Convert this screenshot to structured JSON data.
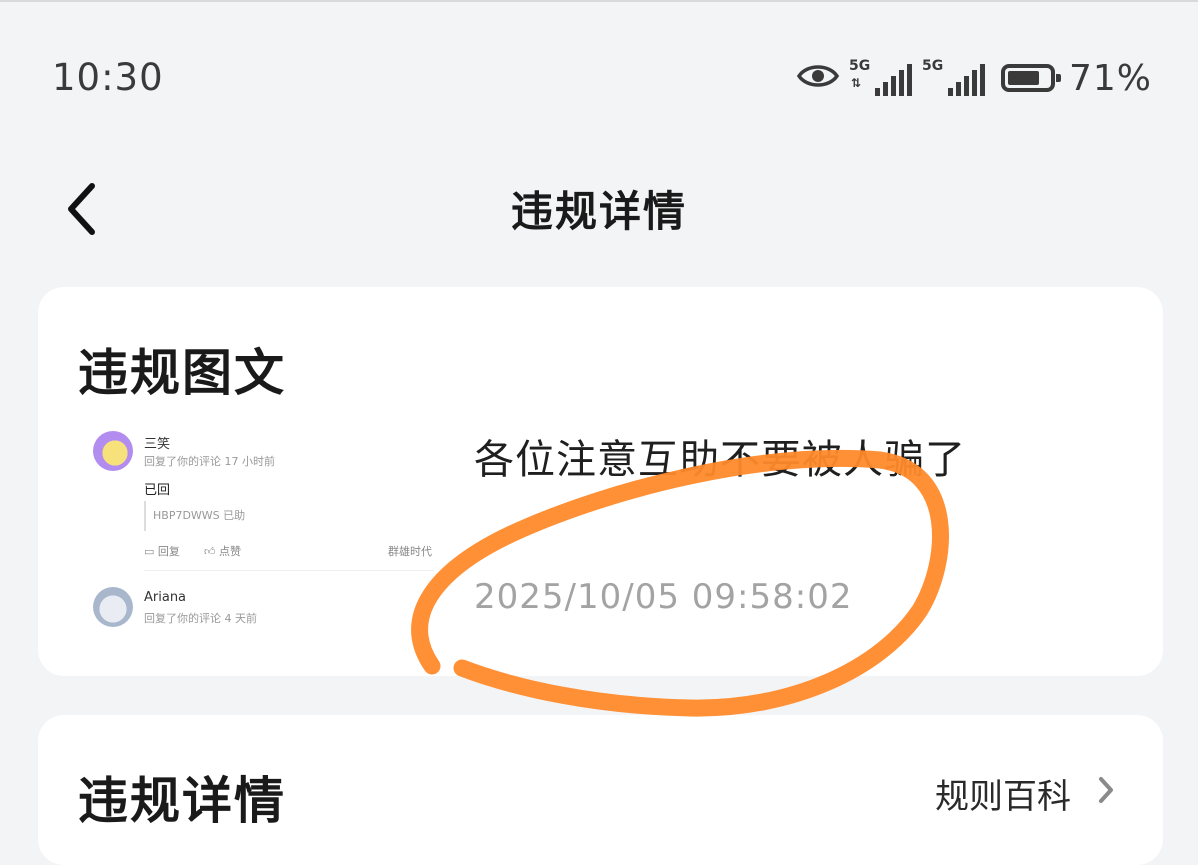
{
  "status_bar": {
    "time": "10:30",
    "network1": "5G",
    "network2": "5G",
    "battery_percent": "71%",
    "battery_level": 0.71
  },
  "nav": {
    "title": "违规详情",
    "back_icon": "chevron-left-icon"
  },
  "violation_post": {
    "section_title": "违规图文",
    "thumbnail": {
      "comment1_name": "三笑",
      "comment1_meta": "回复了你的评论 17 小时前",
      "comment1_reply": "已回",
      "comment1_quote": "HBP7DWWS 已助",
      "action_reply": "回复",
      "action_like": "点赞",
      "source": "群雄时代",
      "comment2_name": "Ariana",
      "comment2_meta": "回复了你的评论 4 天前"
    },
    "text": "各位注意互助不要被人骗了",
    "timestamp": "2025/10/05 09:58:02"
  },
  "violation_details": {
    "section_title": "违规详情",
    "rules_link": "规则百科"
  },
  "colors": {
    "annotation": "#ff8a2b",
    "background": "#f3f4f6",
    "card": "#ffffff"
  }
}
